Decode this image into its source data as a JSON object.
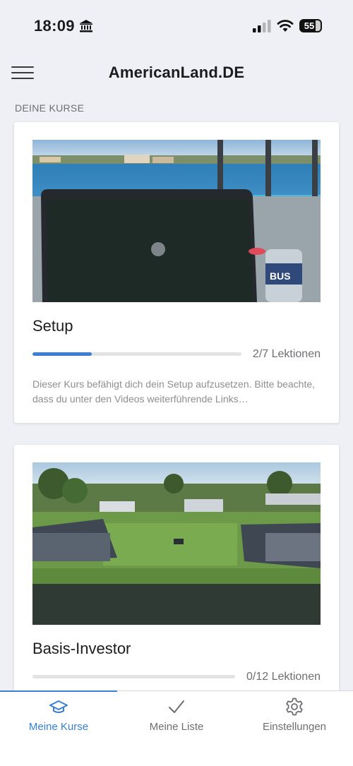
{
  "status_bar": {
    "time": "18:09",
    "battery": "55",
    "icons": [
      "bank-icon",
      "cellular-signal-icon",
      "wifi-icon",
      "battery-icon"
    ]
  },
  "header": {
    "title": "AmericanLand.DE",
    "menu_icon": "hamburger-menu-icon"
  },
  "section": {
    "title": "DEINE KURSE"
  },
  "courses": [
    {
      "title": "Setup",
      "progress_label": "2/7 Lektionen",
      "progress": 0.285,
      "description": "Dieser Kurs befähigt dich dein Setup aufzusetzen. Bitte beachte, dass du unter den Videos weiterführende Links…"
    },
    {
      "title": "Basis-Investor",
      "progress_label": "0/12 Lektionen",
      "progress": 0
    }
  ],
  "tabs": [
    {
      "label": "Meine Kurse",
      "icon": "graduation-cap-icon",
      "active": true
    },
    {
      "label": "Meine Liste",
      "icon": "checkmark-icon",
      "active": false
    },
    {
      "label": "Einstellungen",
      "icon": "gear-icon",
      "active": false
    }
  ],
  "colors": {
    "accent": "#3b7fd4",
    "background": "#eef0f5"
  }
}
